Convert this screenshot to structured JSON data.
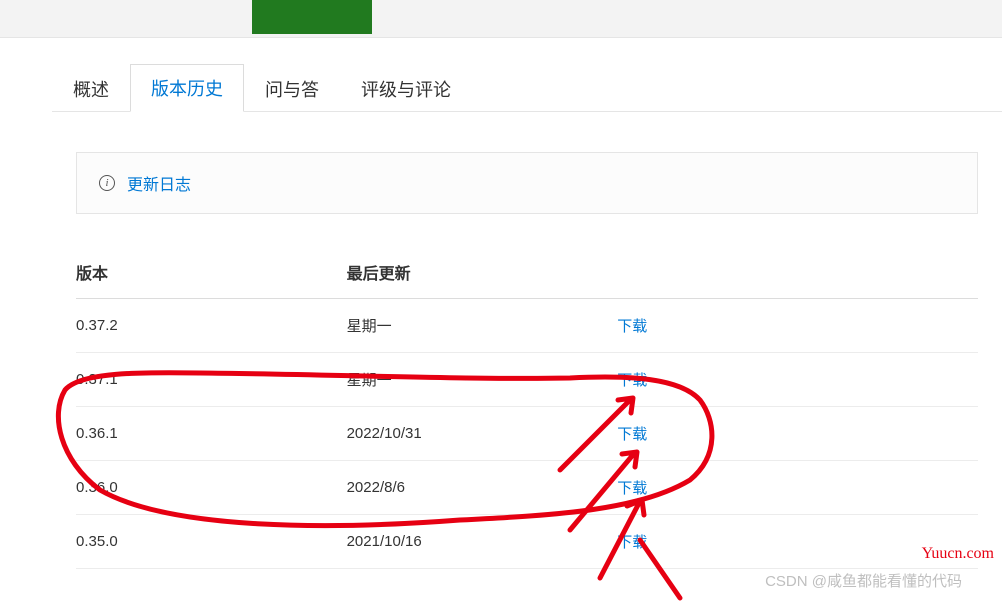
{
  "tabs": {
    "overview": "概述",
    "history": "版本历史",
    "qa": "问与答",
    "reviews": "评级与评论"
  },
  "changelog": {
    "label": "更新日志"
  },
  "table": {
    "headers": {
      "version": "版本",
      "updated": "最后更新"
    },
    "downloadLabel": "下载",
    "rows": [
      {
        "version": "0.37.2",
        "updated": "星期一"
      },
      {
        "version": "0.37.1",
        "updated": "星期一"
      },
      {
        "version": "0.36.1",
        "updated": "2022/10/31"
      },
      {
        "version": "0.36.0",
        "updated": "2022/8/6"
      },
      {
        "version": "0.35.0",
        "updated": "2021/10/16"
      }
    ]
  },
  "watermarks": {
    "csdn": "CSDN @咸鱼都能看懂的代码",
    "site": "Yuucn.com"
  }
}
